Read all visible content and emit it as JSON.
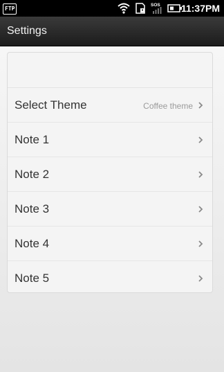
{
  "status_bar": {
    "left_icon_label": "FTP",
    "sos_label": "SOS",
    "time": "11:37PM"
  },
  "header": {
    "title": "Settings"
  },
  "settings": {
    "items": [
      {
        "label": "Select Theme",
        "value": "Coffee theme"
      },
      {
        "label": "Note 1",
        "value": ""
      },
      {
        "label": "Note 2",
        "value": ""
      },
      {
        "label": "Note 3",
        "value": ""
      },
      {
        "label": "Note 4",
        "value": ""
      },
      {
        "label": "Note 5",
        "value": ""
      }
    ]
  }
}
